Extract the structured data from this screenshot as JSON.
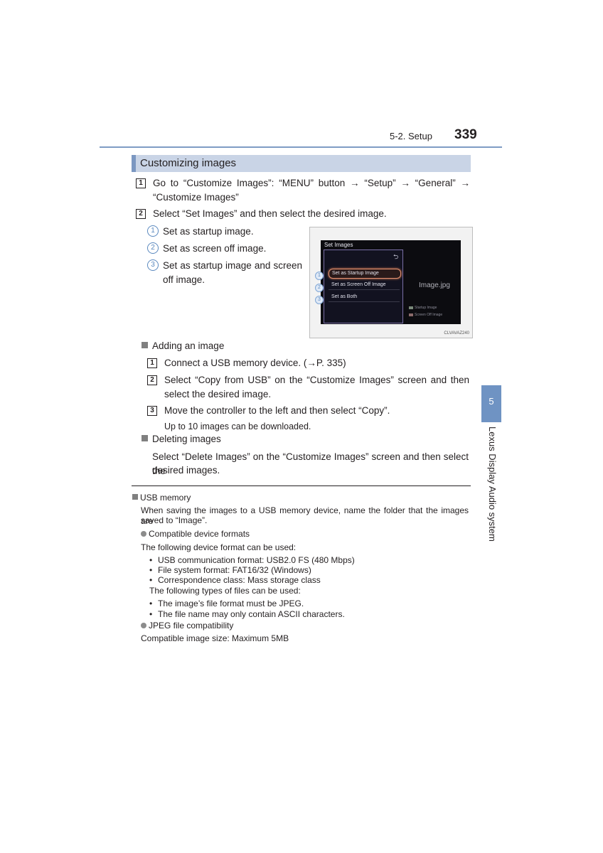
{
  "header": {
    "section": "5-2. Setup",
    "page_number": "339"
  },
  "section_title": "Customizing images",
  "steps": [
    {
      "num": "1",
      "line1": "Go to “Customize Images”: “MENU” button → “Setup” → “General” →",
      "line2": "“Customize Images”"
    },
    {
      "num": "2",
      "text": "Select “Set Images” and then select the desired image."
    }
  ],
  "options": [
    {
      "num": "1",
      "text": "Set as startup image."
    },
    {
      "num": "2",
      "text": "Set as screen off image."
    },
    {
      "num": "3",
      "line1": "Set as startup image and screen",
      "line2": "off image."
    }
  ],
  "figure": {
    "screen_title": "Set Images",
    "back_icon": "back-arrow",
    "menu": [
      {
        "callout": "1",
        "label": "Set as Startup Image",
        "selected": true
      },
      {
        "callout": "2",
        "label": "Set as Screen Off Image",
        "selected": false
      },
      {
        "callout": "3",
        "label": "Set as Both",
        "selected": false
      }
    ],
    "file_name": "Image.jpg",
    "legend": [
      "Startup Image",
      "Screen Off Image"
    ],
    "code": "CLVAVAZ240"
  },
  "adding": {
    "heading": "Adding an image",
    "steps": [
      {
        "num": "1",
        "text": "Connect a USB memory device. (→P. 335)"
      },
      {
        "num": "2",
        "line1": "Select “Copy from USB” on the “Customize Images” screen and then",
        "line2": "select the desired image."
      },
      {
        "num": "3",
        "text": "Move the controller to the left and then select “Copy”."
      }
    ],
    "note": "Up to 10 images can be downloaded."
  },
  "deleting": {
    "heading": "Deleting images",
    "line1": "Select “Delete Images” on the “Customize Images” screen and then select the",
    "line2": "desired images."
  },
  "usb": {
    "heading": "USB memory",
    "line1": "When saving the images to a USB memory device, name the folder that the images are",
    "line2": "saved to “Image”.",
    "formats_heading": "Compatible device formats",
    "formats_intro": "The following device format can be used:",
    "formats": [
      "USB communication format: USB2.0 FS (480 Mbps)",
      "File system format: FAT16/32 (Windows)",
      "Correspondence class: Mass storage class"
    ],
    "files_intro": "The following types of files can be used:",
    "files": [
      "The image’s file format must be JPEG.",
      "The file name may only contain ASCII characters."
    ],
    "jpeg_heading": "JPEG file compatibility",
    "jpeg_text": "Compatible image size: Maximum 5MB"
  },
  "side": {
    "chapter": "5",
    "label": "Lexus Display Audio system"
  },
  "colors": {
    "accent_blue": "#6f93c3",
    "title_bar": "#c9d4e6"
  }
}
